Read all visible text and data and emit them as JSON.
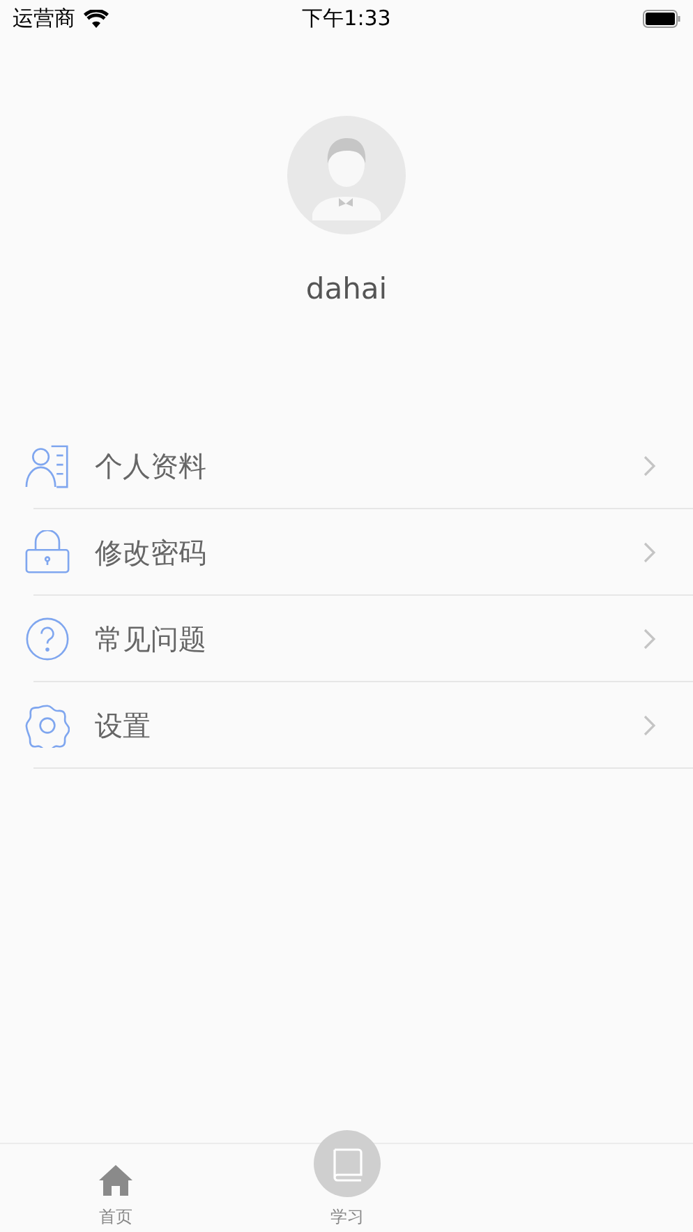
{
  "status_bar": {
    "carrier": "运营商",
    "time": "下午1:33"
  },
  "profile": {
    "name": "dahai"
  },
  "menu": [
    {
      "kind": "profile",
      "label": "个人资料"
    },
    {
      "kind": "lock",
      "label": "修改密码"
    },
    {
      "kind": "help",
      "label": "常见问题"
    },
    {
      "kind": "settings",
      "label": "设置"
    }
  ],
  "tab_bar": [
    {
      "kind": "home",
      "label": "首页"
    },
    {
      "kind": "study",
      "label": "学习"
    }
  ]
}
